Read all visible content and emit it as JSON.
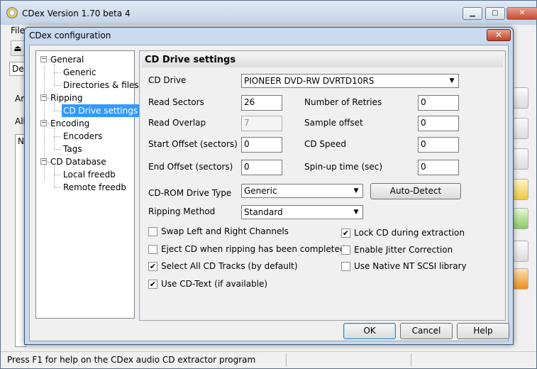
{
  "app": {
    "title": "CDex Version 1.70 beta 4",
    "menu_first": "File",
    "left_frags": [
      "Def",
      "Art",
      "Alb",
      "N"
    ],
    "status_text": "Press F1 for help on the CDex audio CD extractor program"
  },
  "dialog": {
    "title": "CDex configuration",
    "close_label": "✕",
    "tree": [
      {
        "label": "General",
        "level": 0,
        "expander": "−"
      },
      {
        "label": "Generic",
        "level": 1
      },
      {
        "label": "Directories & files",
        "level": 1
      },
      {
        "label": "Ripping",
        "level": 0,
        "expander": "−"
      },
      {
        "label": "CD Drive settings",
        "level": 1,
        "selected": true
      },
      {
        "label": "Encoding",
        "level": 0,
        "expander": "−"
      },
      {
        "label": "Encoders",
        "level": 1
      },
      {
        "label": "Tags",
        "level": 1
      },
      {
        "label": "CD Database",
        "level": 0,
        "expander": "−"
      },
      {
        "label": "Local freedb",
        "level": 1
      },
      {
        "label": "Remote freedb",
        "level": 1
      }
    ],
    "panel": {
      "title": "CD Drive settings",
      "cd_drive_label": "CD Drive",
      "cd_drive_value": "PIONEER DVD-RW DVRTD10RS",
      "read_sectors_label": "Read Sectors",
      "read_sectors_value": "26",
      "read_overlap_label": "Read Overlap",
      "read_overlap_value": "7",
      "start_offset_label": "Start Offset (sectors)",
      "start_offset_value": "0",
      "end_offset_label": "End Offset (sectors)",
      "end_offset_value": "0",
      "retries_label": "Number of Retries",
      "retries_value": "0",
      "sample_offset_label": "Sample offset",
      "sample_offset_value": "0",
      "cd_speed_label": "CD Speed",
      "cd_speed_value": "0",
      "spinup_label": "Spin-up time (sec)",
      "spinup_value": "0",
      "drive_type_label": "CD-ROM Drive Type",
      "drive_type_value": "Generic",
      "auto_detect_label": "Auto-Detect",
      "ripping_method_label": "Ripping Method",
      "ripping_method_value": "Standard",
      "checkboxes_left": [
        {
          "label": "Swap Left and Right Channels",
          "checked": false
        },
        {
          "label": "Eject CD when ripping has been completed",
          "checked": false
        },
        {
          "label": "Select All CD Tracks (by default)",
          "checked": true
        },
        {
          "label": "Use CD-Text (if available)",
          "checked": true
        }
      ],
      "checkboxes_right": [
        {
          "label": "Lock CD during extraction",
          "checked": true
        },
        {
          "label": "Enable Jitter Correction",
          "checked": false
        },
        {
          "label": "Use Native NT SCSI library",
          "checked": false
        }
      ]
    },
    "buttons": {
      "ok": "OK",
      "cancel": "Cancel",
      "help": "Help"
    }
  }
}
